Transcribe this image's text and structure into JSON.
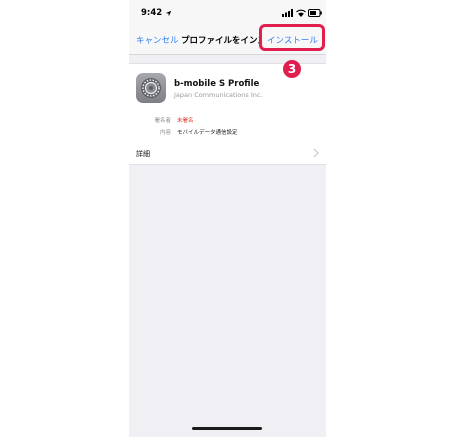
{
  "status_bar": {
    "time": "9:42"
  },
  "nav": {
    "cancel_label": "キャンセル",
    "title": "プロファイルをインストール",
    "install_label": "インストール"
  },
  "profile": {
    "name": "b-mobile S Profile",
    "organization": "Japan Communications Inc.",
    "signer_label": "署名者",
    "signer_value": "未署名",
    "contents_label": "内容",
    "contents_value": "モバイルデータ通信設定"
  },
  "details": {
    "label": "詳細"
  },
  "annotation": {
    "step": "3"
  },
  "colors": {
    "accent": "#2f7ef5",
    "highlight": "#e01f4e",
    "unsigned": "#e3352b"
  },
  "icons": [
    "location-icon",
    "signal-icon",
    "wifi-icon",
    "battery-icon",
    "settings-gear-icon",
    "chevron-right-icon"
  ]
}
